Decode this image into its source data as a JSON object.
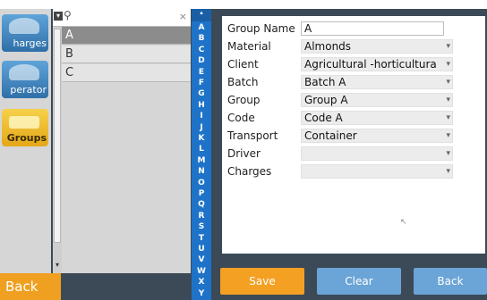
{
  "nav": {
    "items": [
      {
        "label": "harges",
        "icon": "truck-icon"
      },
      {
        "label": "perator",
        "icon": "operator-icon"
      },
      {
        "label": "Groups",
        "icon": "folder-icon"
      }
    ],
    "back_label": "Back"
  },
  "search": {
    "placeholder": "",
    "value": ""
  },
  "list": {
    "items": [
      "A",
      "B",
      "C"
    ],
    "selected": "A"
  },
  "alphabet": [
    "A",
    "B",
    "C",
    "D",
    "E",
    "F",
    "G",
    "H",
    "I",
    "J",
    "K",
    "L",
    "M",
    "N",
    "O",
    "P",
    "Q",
    "R",
    "S",
    "T",
    "U",
    "V",
    "W",
    "X",
    "Y"
  ],
  "form": {
    "group_name": {
      "label": "Group Name",
      "value": "A"
    },
    "material": {
      "label": "Material",
      "value": "Almonds"
    },
    "client": {
      "label": "Client",
      "value": "Agricultural -horticultura"
    },
    "batch": {
      "label": "Batch",
      "value": "Batch A"
    },
    "group": {
      "label": "Group",
      "value": "Group A"
    },
    "code": {
      "label": "Code",
      "value": "Code A"
    },
    "transport": {
      "label": "Transport",
      "value": "Container"
    },
    "driver": {
      "label": "Driver",
      "value": ""
    },
    "charges": {
      "label": "Charges",
      "value": ""
    }
  },
  "actions": {
    "save_label": "Save",
    "clear_label": "Clear",
    "back_label": "Back"
  },
  "colors": {
    "accent_orange": "#f4a023",
    "accent_blue": "#6ba4d6",
    "index_blue": "#1e73c8"
  }
}
